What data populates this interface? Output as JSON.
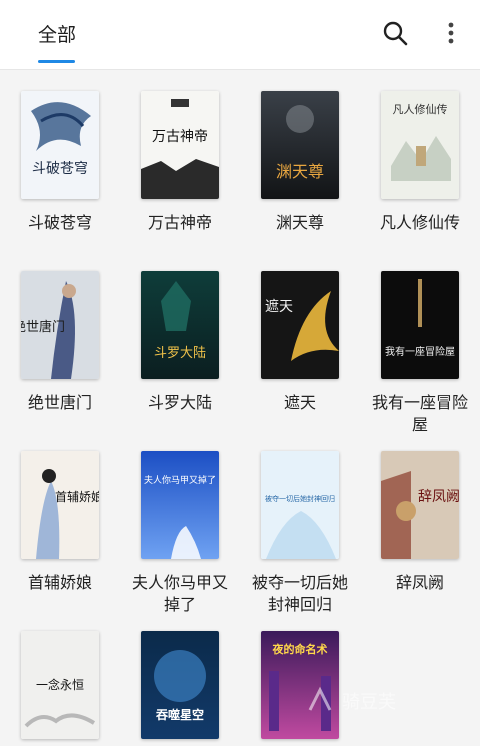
{
  "header": {
    "tab_label": "全部"
  },
  "books": [
    {
      "title": "斗破苍穹",
      "cover_text": "斗破苍穹"
    },
    {
      "title": "万古神帝",
      "cover_text": "万古神帝"
    },
    {
      "title": "渊天尊",
      "cover_text": "渊天尊"
    },
    {
      "title": "凡人修仙传",
      "cover_text": "凡人修仙传"
    },
    {
      "title": "绝世唐门",
      "cover_text": "绝世唐门"
    },
    {
      "title": "斗罗大陆",
      "cover_text": "斗罗大陆"
    },
    {
      "title": "遮天",
      "cover_text": "遮天"
    },
    {
      "title": "我有一座冒险屋",
      "cover_text": "我有一座冒险屋"
    },
    {
      "title": "首辅娇娘",
      "cover_text": "首辅娇娘"
    },
    {
      "title": "夫人你马甲又掉了",
      "cover_text": "夫人你马甲又掉了"
    },
    {
      "title": "被夺一切后她封神回归",
      "cover_text": "被夺一切后她封神回归"
    },
    {
      "title": "辞凤阙",
      "cover_text": "辞凤阙"
    },
    {
      "title": "",
      "cover_text": "一念永恒"
    },
    {
      "title": "",
      "cover_text": "吞噬星空"
    },
    {
      "title": "",
      "cover_text": "夜的命名术"
    }
  ],
  "watermark": {
    "text": "骑豆芙"
  }
}
